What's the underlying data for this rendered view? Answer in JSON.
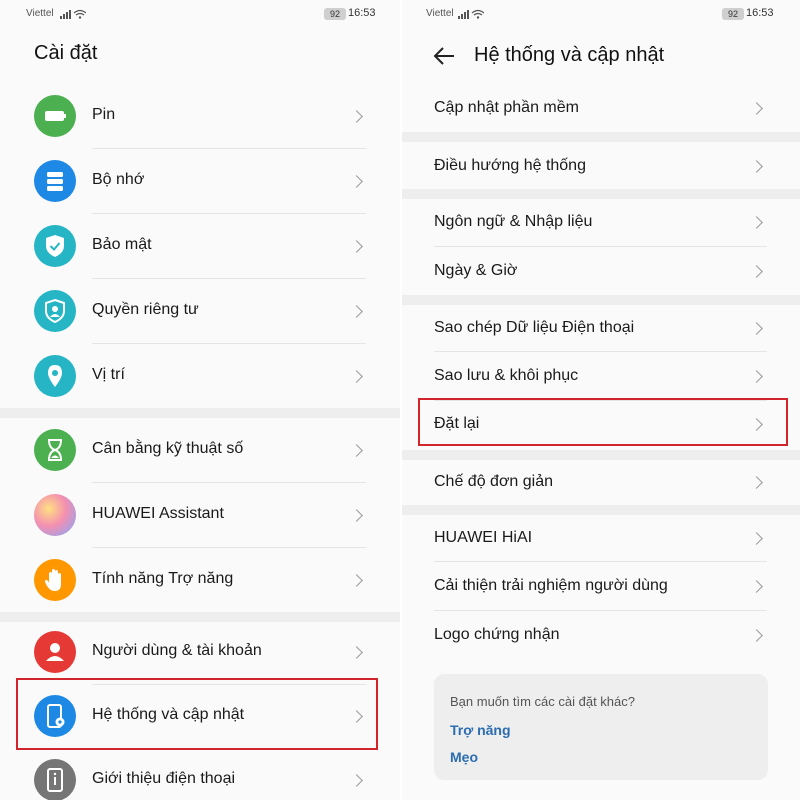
{
  "left": {
    "status": {
      "carrier": "Viettel",
      "battery": "92",
      "time": "16:53"
    },
    "title": "Cài đặt",
    "items": [
      {
        "label": "Pin",
        "icon": "battery-icon",
        "color": "#4caf50"
      },
      {
        "label": "Bộ nhớ",
        "icon": "storage-icon",
        "color": "#1e88e5"
      },
      {
        "label": "Bảo mật",
        "icon": "shield-check-icon",
        "color": "#26b5c5"
      },
      {
        "label": "Quyền riêng tư",
        "icon": "privacy-icon",
        "color": "#26b5c5"
      },
      {
        "label": "Vị trí",
        "icon": "location-pin-icon",
        "color": "#26b5c5"
      },
      {
        "label": "Cân bằng kỹ thuật số",
        "icon": "hourglass-icon",
        "color": "#4caf50"
      },
      {
        "label": "HUAWEI Assistant",
        "icon": "assistant-icon",
        "color": "#f48fb1"
      },
      {
        "label": "Tính năng Trợ năng",
        "icon": "hand-icon",
        "color": "#ff9800"
      },
      {
        "label": "Người dùng & tài khoản",
        "icon": "user-icon",
        "color": "#e53935"
      },
      {
        "label": "Hệ thống và cập nhật",
        "icon": "phone-settings-icon",
        "color": "#1e88e5"
      },
      {
        "label": "Giới thiệu điện thoại",
        "icon": "phone-info-icon",
        "color": "#757575"
      }
    ]
  },
  "right": {
    "status": {
      "carrier": "Viettel",
      "battery": "92",
      "time": "16:53"
    },
    "title": "Hệ thống và cập nhật",
    "items": [
      {
        "label": "Cập nhật phần mềm"
      },
      {
        "label": "Điều hướng hệ thống"
      },
      {
        "label": "Ngôn ngữ & Nhập liệu"
      },
      {
        "label": "Ngày & Giờ"
      },
      {
        "label": "Sao chép Dữ liệu Điện thoại"
      },
      {
        "label": "Sao lưu & khôi phục"
      },
      {
        "label": "Đặt lại"
      },
      {
        "label": "Chế độ đơn giản"
      },
      {
        "label": "HUAWEI HiAI"
      },
      {
        "label": "Cải thiện trải nghiệm người dùng"
      },
      {
        "label": "Logo chứng nhận"
      }
    ],
    "suggest": {
      "question": "Bạn muốn tìm các cài đặt khác?",
      "links": [
        "Trợ năng",
        "Mẹo"
      ]
    }
  },
  "colors": {
    "highlight_box": "#d2252b",
    "link": "#2b6db0"
  }
}
